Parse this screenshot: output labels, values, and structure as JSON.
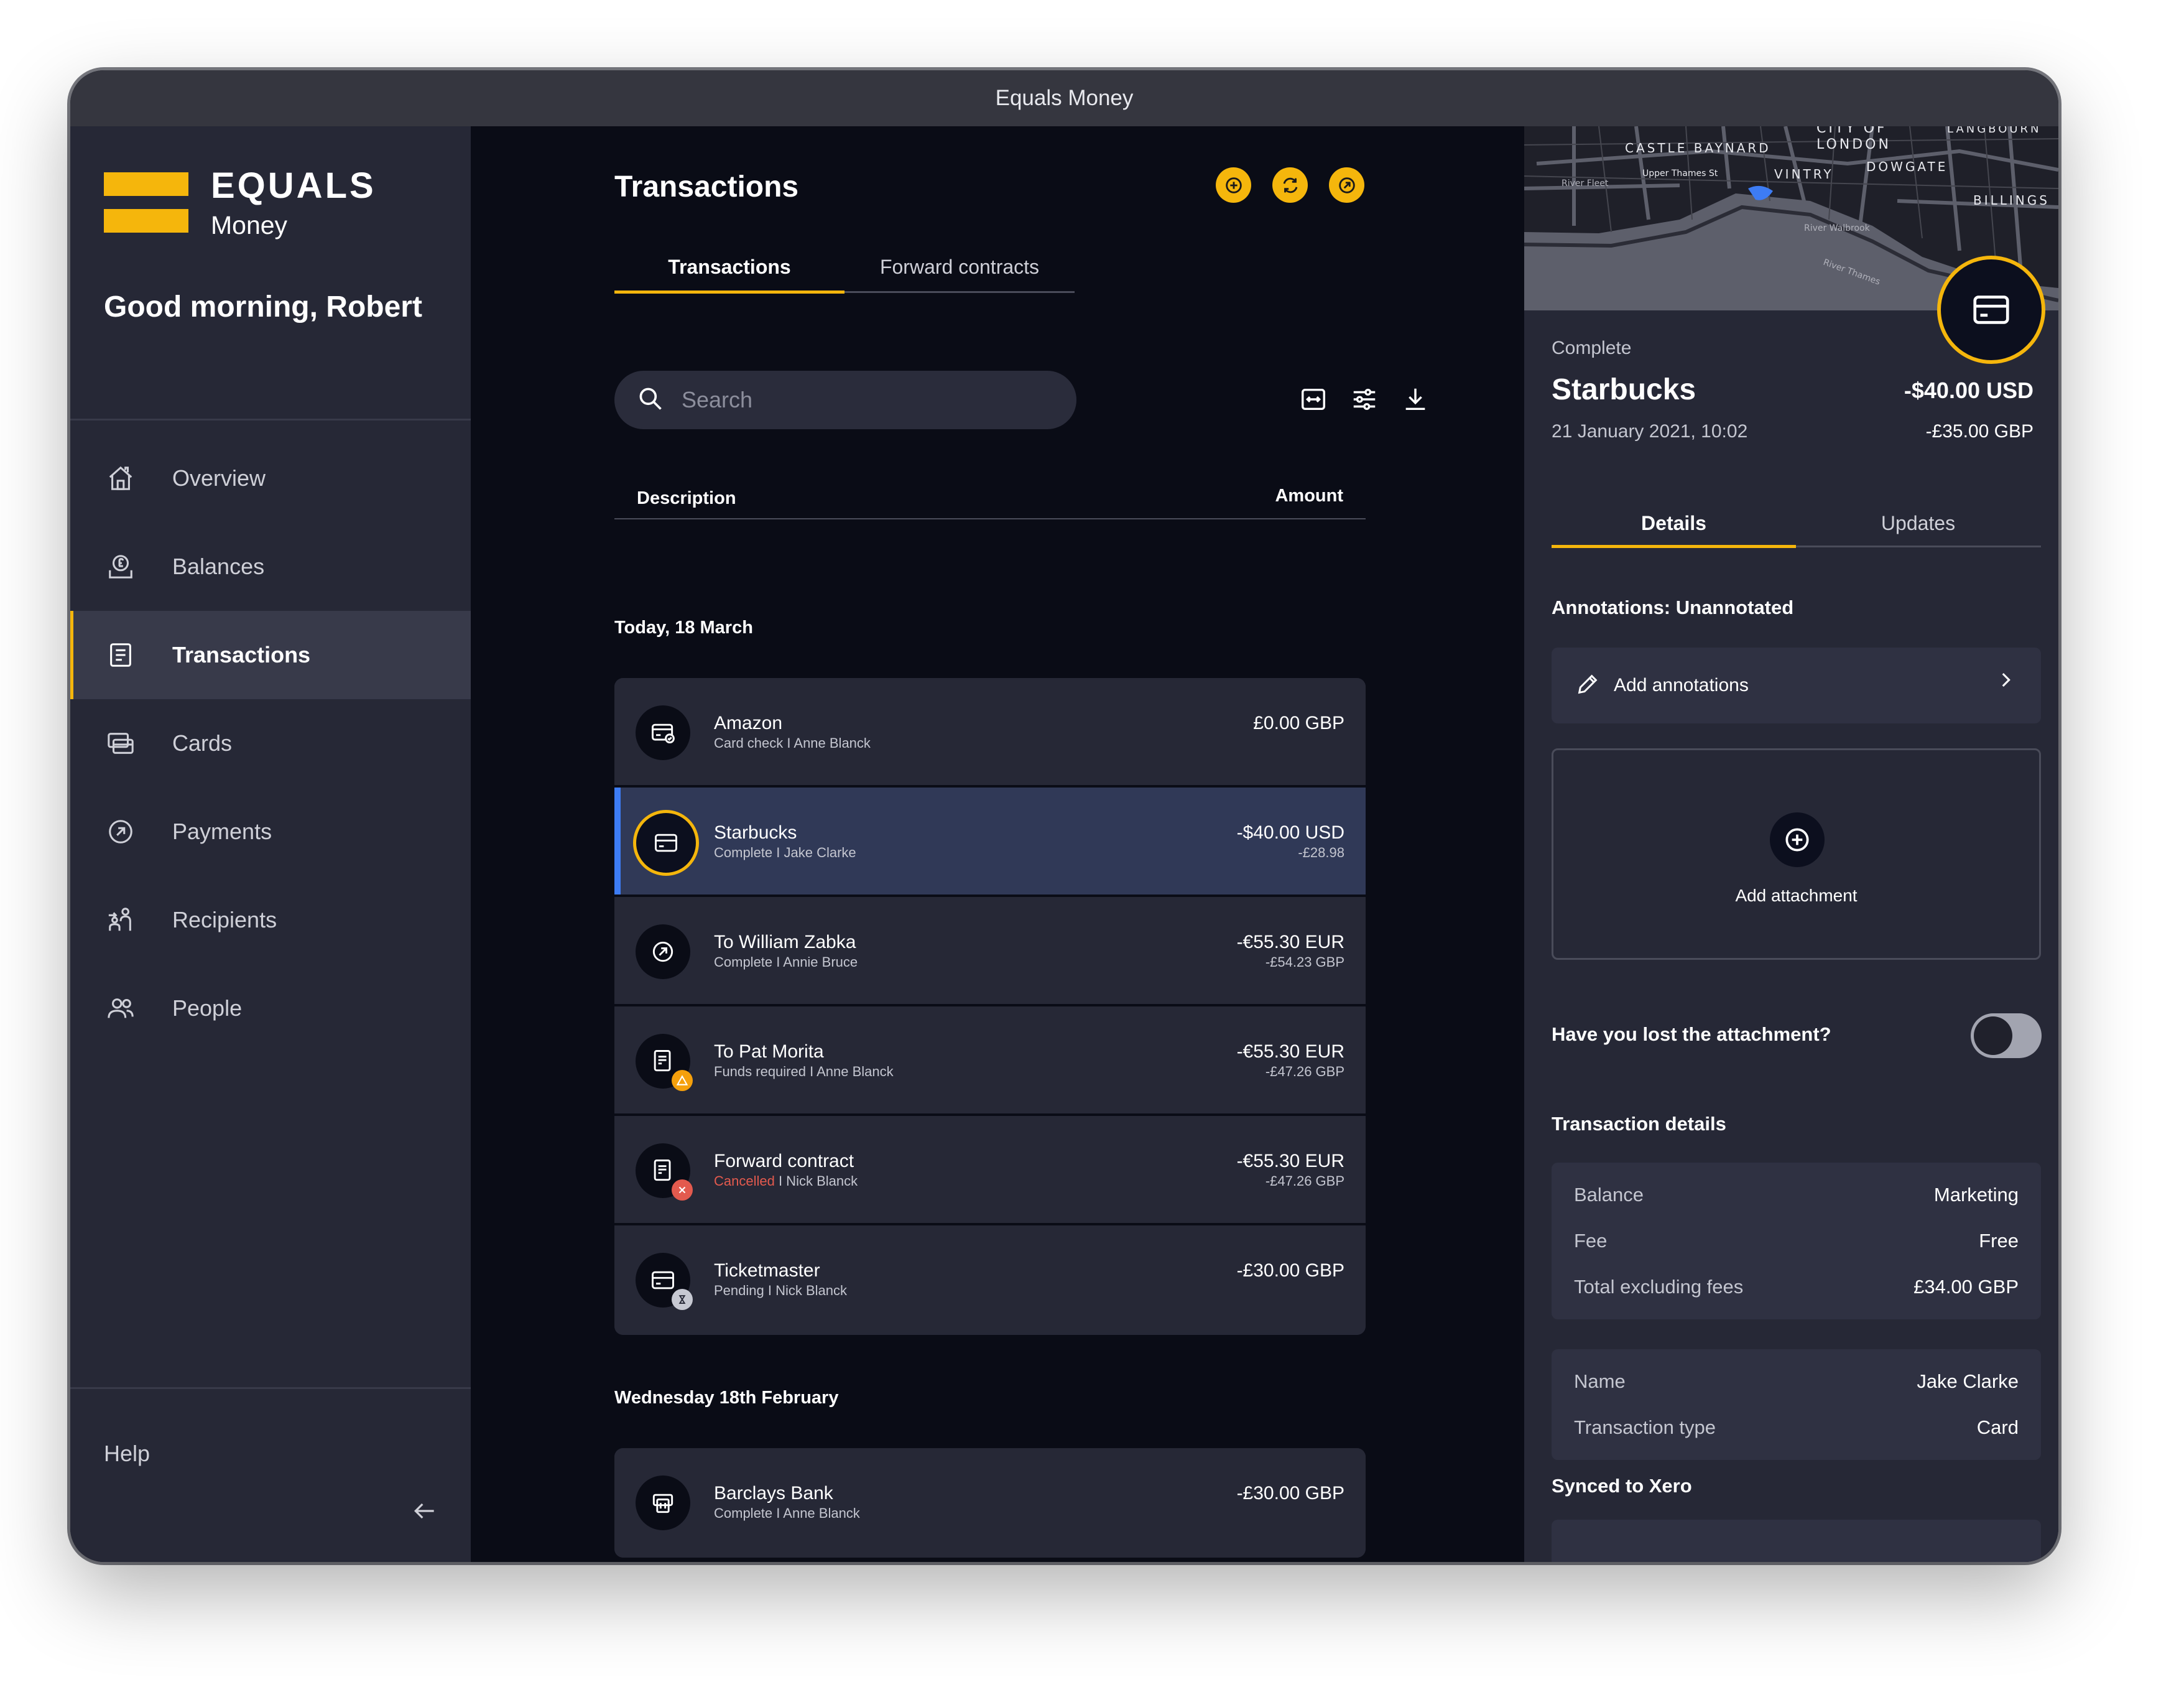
{
  "window": {
    "title": "Equals Money"
  },
  "brand": {
    "name": "EQUALS",
    "sub": "Money"
  },
  "sidebar": {
    "greeting": "Good morning, Robert",
    "items": [
      {
        "label": "Overview",
        "icon": "home-icon"
      },
      {
        "label": "Balances",
        "icon": "balances-icon"
      },
      {
        "label": "Transactions",
        "icon": "transactions-icon",
        "active": true
      },
      {
        "label": "Cards",
        "icon": "cards-icon"
      },
      {
        "label": "Payments",
        "icon": "payments-icon"
      },
      {
        "label": "Recipients",
        "icon": "recipients-icon"
      },
      {
        "label": "People",
        "icon": "people-icon"
      }
    ],
    "help": "Help"
  },
  "main": {
    "title": "Transactions",
    "tabs": [
      "Transactions",
      "Forward contracts"
    ],
    "search": {
      "placeholder": "Search",
      "value": ""
    },
    "columns": {
      "description": "Description",
      "amount": "Amount"
    },
    "groups": [
      {
        "label": "Today, 18 March",
        "items": [
          {
            "name": "Amazon",
            "sub": "Card check I Anne Blanck",
            "amount": "£0.00 GBP",
            "amount2": ""
          },
          {
            "name": "Starbucks",
            "sub": "Complete I Jake Clarke",
            "amount": "-$40.00 USD",
            "amount2": "-£28.98",
            "selected": true
          },
          {
            "name": "To William Zabka",
            "sub": "Complete I Annie Bruce",
            "amount": "-€55.30 EUR",
            "amount2": "-£54.23 GBP"
          },
          {
            "name": "To Pat Morita",
            "sub": "Funds required I Anne Blanck",
            "amount": "-€55.30 EUR",
            "amount2": "-£47.26 GBP"
          },
          {
            "name": "Forward contract",
            "sub_status": "Cancelled",
            "sub": " I Nick Blanck",
            "amount": "-€55.30 EUR",
            "amount2": "-£47.26 GBP"
          },
          {
            "name": "Ticketmaster",
            "sub": "Pending  I Nick Blanck",
            "amount": "-£30.00 GBP",
            "amount2": ""
          }
        ]
      },
      {
        "label": "Wednesday 18th February",
        "items": [
          {
            "name": "Barclays Bank",
            "sub": "Complete I Anne Blanck",
            "amount": "-£30.00 GBP",
            "amount2": ""
          }
        ]
      }
    ]
  },
  "panel": {
    "map_labels": [
      "CASTLE BAYNARD",
      "CITY OF",
      "LONDON",
      "LANGBOURN",
      "VINTRY",
      "DOWGATE",
      "BILLINGS",
      "Upper Thames St",
      "River Fleet",
      "River Walbrook",
      "River Thames"
    ],
    "status": "Complete",
    "merchant": "Starbucks",
    "date": "21 January 2021, 10:02",
    "amount": "-$40.00 USD",
    "amount2": "-£35.00 GBP",
    "tabs": [
      "Details",
      "Updates"
    ],
    "annotations_title": "Annotations: Unannotated",
    "add_annotations": "Add annotations",
    "add_attachment": "Add attachment",
    "lost_attachment": "Have you lost the attachment?",
    "details_title": "Transaction details",
    "details": [
      {
        "k": "Balance",
        "v": "Marketing"
      },
      {
        "k": "Fee",
        "v": "Free"
      },
      {
        "k": "Total excluding fees",
        "v": "£34.00 GBP"
      }
    ],
    "details2": [
      {
        "k": "Name",
        "v": "Jake Clarke"
      },
      {
        "k": "Transaction type",
        "v": "Card"
      }
    ],
    "synced_title": "Synced to Xero"
  },
  "colors": {
    "accent": "#f5b60c",
    "selected": "#3d7cf4",
    "danger": "#e35a4e"
  }
}
